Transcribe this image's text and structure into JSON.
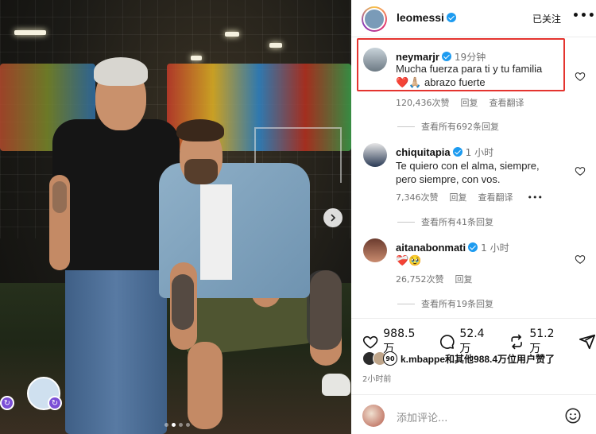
{
  "post": {
    "author": "leomessi",
    "follow_status": "已关注",
    "more": "•••"
  },
  "comments": [
    {
      "user": "neymarjr",
      "time": "19分钟",
      "text_line1": "Mucha fuerza para ti y tu familia",
      "text_line2": "❤️🙏🏼 abrazo fuerte",
      "likes": "120,436次赞",
      "reply": "回复",
      "translate": "查看翻译",
      "view_replies": "查看所有692条回复"
    },
    {
      "user": "chiquitapia",
      "time": "1 小时",
      "text_line1": "Te quiero con el alma, siempre,",
      "text_line2": "pero siempre, con vos.",
      "likes": "7,346次赞",
      "reply": "回复",
      "translate": "查看翻译",
      "more": "•••",
      "view_replies": "查看所有41条回复"
    },
    {
      "user": "aitanabonmati",
      "time": "1 小时",
      "text_line1": "❤️‍🩹🥹",
      "likes": "26,752次赞",
      "reply": "回复",
      "view_replies": "查看所有19条回复"
    }
  ],
  "actions": {
    "likes": "988.5 万",
    "comments": "52.4 万",
    "reposts": "51.2 万"
  },
  "liked_by": "k.mbappe和其他988.4万位用户赞了",
  "liked_by_badge": "90",
  "post_time": "2小时前",
  "add_comment_placeholder": "添加评论...",
  "colors": {
    "highlight": "#e4342f",
    "verified": "#1d9bf0"
  }
}
